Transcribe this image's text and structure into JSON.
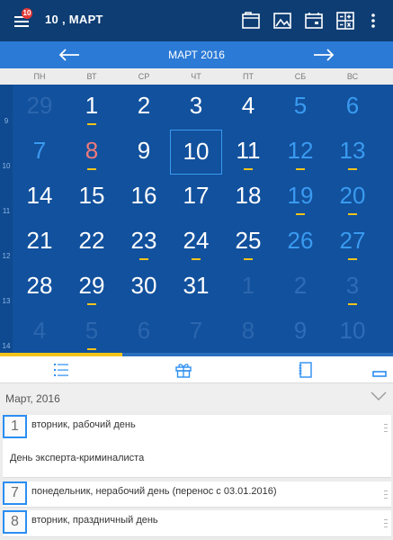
{
  "app_bar": {
    "title": "10 , МАРТ",
    "badge": "10",
    "actions": [
      "folder-icon",
      "image-icon",
      "calendar-icon",
      "calculator-icon",
      "more-vert-icon"
    ]
  },
  "month_nav": {
    "title": "МАРТ 2016",
    "prev_icon": "arrow-left-icon",
    "next_icon": "arrow-right-icon"
  },
  "weekdays": [
    "ПН",
    "ВТ",
    "СР",
    "ЧТ",
    "ПТ",
    "СБ",
    "ВС"
  ],
  "week_numbers": [
    "9",
    "10",
    "11",
    "12",
    "13",
    "14"
  ],
  "calendar": {
    "rows": [
      [
        {
          "d": "29",
          "s": "dim"
        },
        {
          "d": "1",
          "s": "normal",
          "m": true
        },
        {
          "d": "2",
          "s": "normal"
        },
        {
          "d": "3",
          "s": "normal"
        },
        {
          "d": "4",
          "s": "normal"
        },
        {
          "d": "5",
          "s": "blue"
        },
        {
          "d": "6",
          "s": "blue"
        }
      ],
      [
        {
          "d": "7",
          "s": "blue"
        },
        {
          "d": "8",
          "s": "red",
          "m": true
        },
        {
          "d": "9",
          "s": "normal"
        },
        {
          "d": "10",
          "s": "today"
        },
        {
          "d": "11",
          "s": "normal",
          "m": true
        },
        {
          "d": "12",
          "s": "blue",
          "m": true
        },
        {
          "d": "13",
          "s": "blue",
          "m": true
        }
      ],
      [
        {
          "d": "14",
          "s": "normal"
        },
        {
          "d": "15",
          "s": "normal"
        },
        {
          "d": "16",
          "s": "normal"
        },
        {
          "d": "17",
          "s": "normal"
        },
        {
          "d": "18",
          "s": "normal"
        },
        {
          "d": "19",
          "s": "blue",
          "m": true
        },
        {
          "d": "20",
          "s": "blue",
          "m": true
        }
      ],
      [
        {
          "d": "21",
          "s": "normal"
        },
        {
          "d": "22",
          "s": "normal"
        },
        {
          "d": "23",
          "s": "normal",
          "m": true
        },
        {
          "d": "24",
          "s": "normal",
          "m": true
        },
        {
          "d": "25",
          "s": "normal",
          "m": true
        },
        {
          "d": "26",
          "s": "blue"
        },
        {
          "d": "27",
          "s": "blue",
          "m": true
        }
      ],
      [
        {
          "d": "28",
          "s": "normal"
        },
        {
          "d": "29",
          "s": "normal",
          "m": true
        },
        {
          "d": "30",
          "s": "normal"
        },
        {
          "d": "31",
          "s": "normal"
        },
        {
          "d": "1",
          "s": "dim"
        },
        {
          "d": "2",
          "s": "dim-blue"
        },
        {
          "d": "3",
          "s": "dim-blue",
          "m": true
        }
      ],
      [
        {
          "d": "4",
          "s": "dim"
        },
        {
          "d": "5",
          "s": "dim",
          "m": true
        },
        {
          "d": "6",
          "s": "dim"
        },
        {
          "d": "7",
          "s": "dim"
        },
        {
          "d": "8",
          "s": "dim"
        },
        {
          "d": "9",
          "s": "dim-blue"
        },
        {
          "d": "10",
          "s": "dim-blue"
        }
      ]
    ]
  },
  "tabs": [
    "list-icon",
    "gift-icon",
    "notebook-icon",
    "minimize-icon"
  ],
  "list": {
    "header": "Март, 2016",
    "events": [
      {
        "day": "1",
        "label": "вторник, рабочий день",
        "desc": "День эксперта-криминалиста"
      },
      {
        "day": "7",
        "label": "понедельник, нерабочий день (перенос с 03.01.2016)",
        "desc": ""
      },
      {
        "day": "8",
        "label": "вторник, праздничный день",
        "desc": ""
      }
    ]
  },
  "colors": {
    "app_bar": "#0e3d73",
    "month_bar": "#2b7ad6",
    "calendar_bg": "#12519d",
    "weekend": "#3a9af0",
    "holiday": "#f07a7a",
    "marker": "#f2c31b"
  }
}
